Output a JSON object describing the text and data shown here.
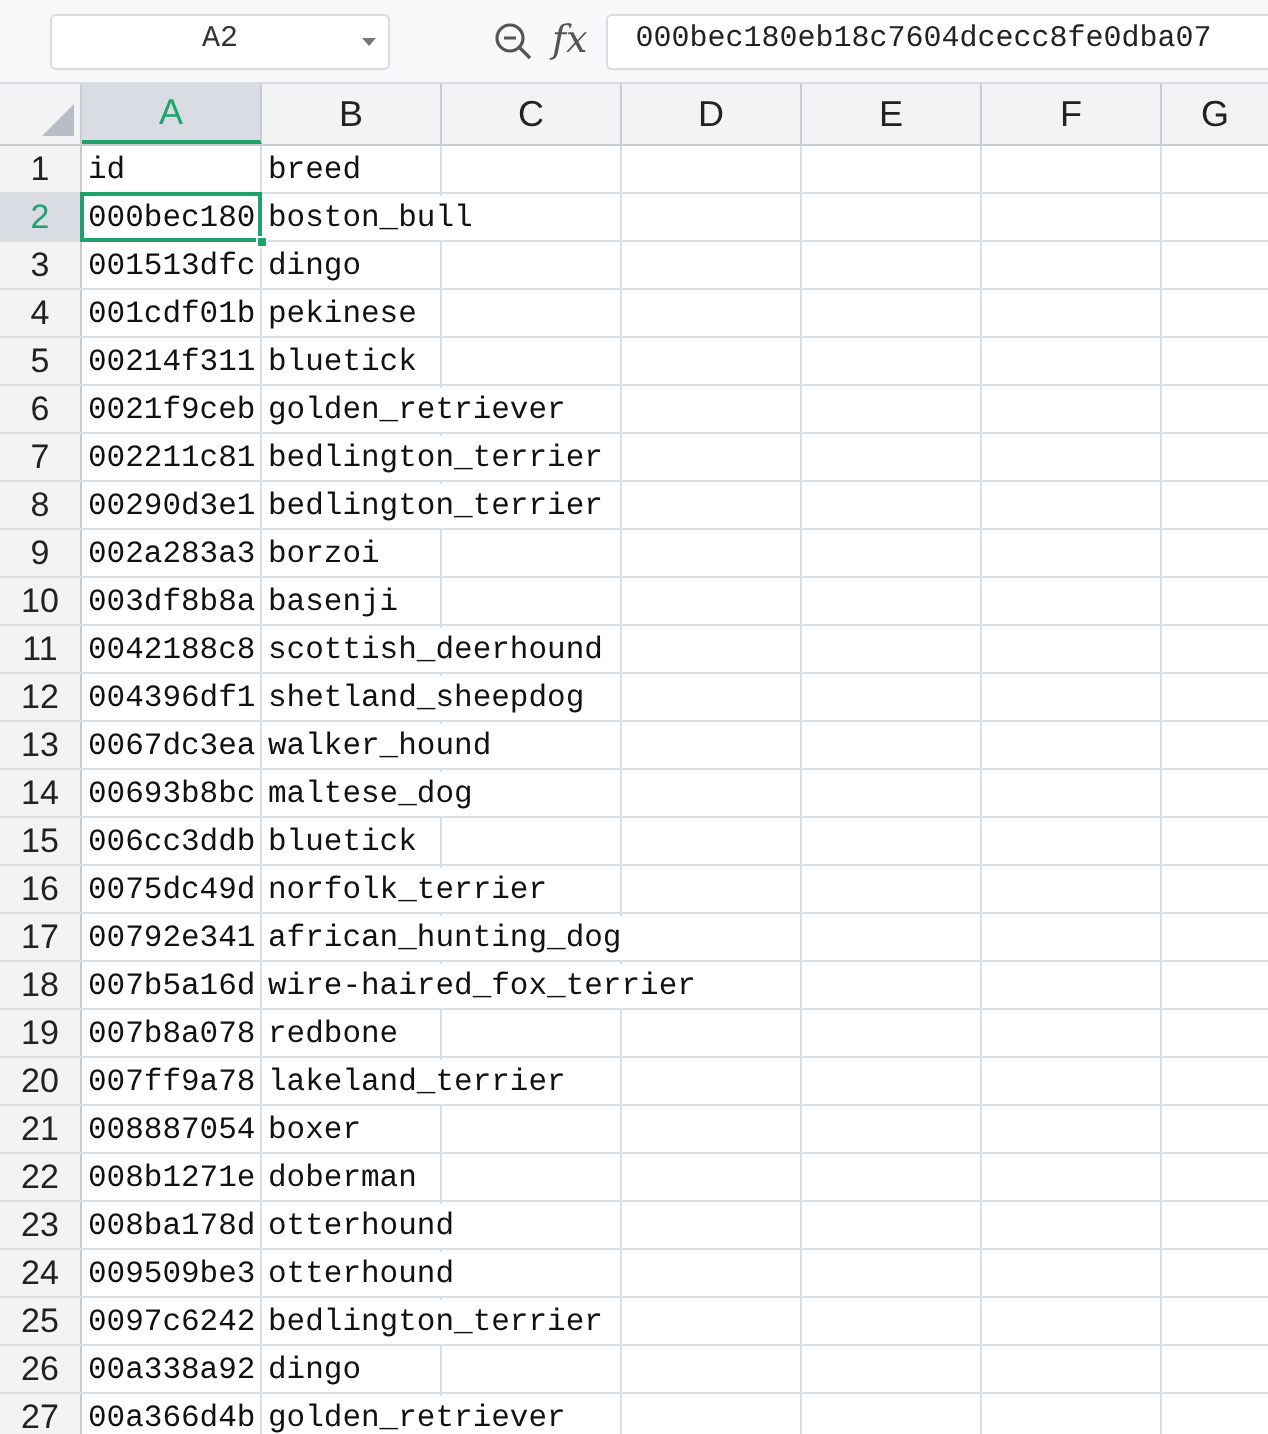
{
  "name_box": {
    "value": "A2"
  },
  "formula_bar": {
    "function_label": "fx",
    "value": "000bec180eb18c7604dcecc8fe0dba07"
  },
  "columns": [
    {
      "label": "A",
      "selected": true
    },
    {
      "label": "B",
      "selected": false
    },
    {
      "label": "C",
      "selected": false
    },
    {
      "label": "D",
      "selected": false
    },
    {
      "label": "E",
      "selected": false
    },
    {
      "label": "F",
      "selected": false
    },
    {
      "label": "G",
      "selected": false
    }
  ],
  "rows": [
    {
      "number": "1",
      "selected": false,
      "cells": [
        "id",
        "breed"
      ]
    },
    {
      "number": "2",
      "selected": true,
      "cells": [
        "000bec180",
        "boston_bull"
      ]
    },
    {
      "number": "3",
      "selected": false,
      "cells": [
        "001513dfc",
        "dingo"
      ]
    },
    {
      "number": "4",
      "selected": false,
      "cells": [
        "001cdf01b",
        "pekinese"
      ]
    },
    {
      "number": "5",
      "selected": false,
      "cells": [
        "00214f311",
        "bluetick"
      ]
    },
    {
      "number": "6",
      "selected": false,
      "cells": [
        "0021f9ceb",
        "golden_retriever"
      ]
    },
    {
      "number": "7",
      "selected": false,
      "cells": [
        "002211c81",
        "bedlington_terrier"
      ]
    },
    {
      "number": "8",
      "selected": false,
      "cells": [
        "00290d3e1",
        "bedlington_terrier"
      ]
    },
    {
      "number": "9",
      "selected": false,
      "cells": [
        "002a283a3",
        "borzoi"
      ]
    },
    {
      "number": "10",
      "selected": false,
      "cells": [
        "003df8b8a",
        "basenji"
      ]
    },
    {
      "number": "11",
      "selected": false,
      "cells": [
        "0042188c8",
        "scottish_deerhound"
      ]
    },
    {
      "number": "12",
      "selected": false,
      "cells": [
        "004396df1",
        "shetland_sheepdog"
      ]
    },
    {
      "number": "13",
      "selected": false,
      "cells": [
        "0067dc3ea",
        "walker_hound"
      ]
    },
    {
      "number": "14",
      "selected": false,
      "cells": [
        "00693b8bc",
        "maltese_dog"
      ]
    },
    {
      "number": "15",
      "selected": false,
      "cells": [
        "006cc3ddb",
        "bluetick"
      ]
    },
    {
      "number": "16",
      "selected": false,
      "cells": [
        "0075dc49d",
        "norfolk_terrier"
      ]
    },
    {
      "number": "17",
      "selected": false,
      "cells": [
        "00792e341",
        "african_hunting_dog"
      ]
    },
    {
      "number": "18",
      "selected": false,
      "cells": [
        "007b5a16d",
        "wire-haired_fox_terrier"
      ]
    },
    {
      "number": "19",
      "selected": false,
      "cells": [
        "007b8a078",
        "redbone"
      ]
    },
    {
      "number": "20",
      "selected": false,
      "cells": [
        "007ff9a78",
        "lakeland_terrier"
      ]
    },
    {
      "number": "21",
      "selected": false,
      "cells": [
        "008887054",
        "boxer"
      ]
    },
    {
      "number": "22",
      "selected": false,
      "cells": [
        "008b1271e",
        "doberman"
      ]
    },
    {
      "number": "23",
      "selected": false,
      "cells": [
        "008ba178d",
        "otterhound"
      ]
    },
    {
      "number": "24",
      "selected": false,
      "cells": [
        "009509be3",
        "otterhound"
      ]
    },
    {
      "number": "25",
      "selected": false,
      "cells": [
        "0097c6242",
        "bedlington_terrier"
      ]
    },
    {
      "number": "26",
      "selected": false,
      "cells": [
        "00a338a92",
        "dingo"
      ]
    },
    {
      "number": "27",
      "selected": false,
      "cells": [
        "00a366d4b",
        "golden_retriever"
      ]
    }
  ]
}
